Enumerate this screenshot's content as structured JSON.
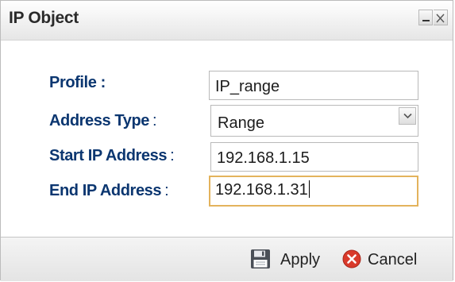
{
  "window": {
    "title": "IP Object",
    "minimize_icon": "minimize-icon",
    "close_icon": "close-icon"
  },
  "form": {
    "profile": {
      "label": "Profile :",
      "value": "IP_range"
    },
    "address_type": {
      "label": "Address Type",
      "colon": ":",
      "selected": "Range",
      "dropdown_icon": "chevron-down-icon"
    },
    "start_ip": {
      "label": "Start IP Address",
      "colon": ":",
      "value": "192.168.1.15"
    },
    "end_ip": {
      "label": "End IP Address",
      "colon": ":",
      "value": "192.168.1.31",
      "focused": true
    }
  },
  "footer": {
    "apply_label": "Apply",
    "apply_icon": "floppy-disk-icon",
    "cancel_label": "Cancel",
    "cancel_icon": "cancel-x-icon"
  },
  "colors": {
    "label_text": "#0b3670",
    "focus_border": "#e3b35c",
    "cancel_icon": "#d93a2b"
  }
}
